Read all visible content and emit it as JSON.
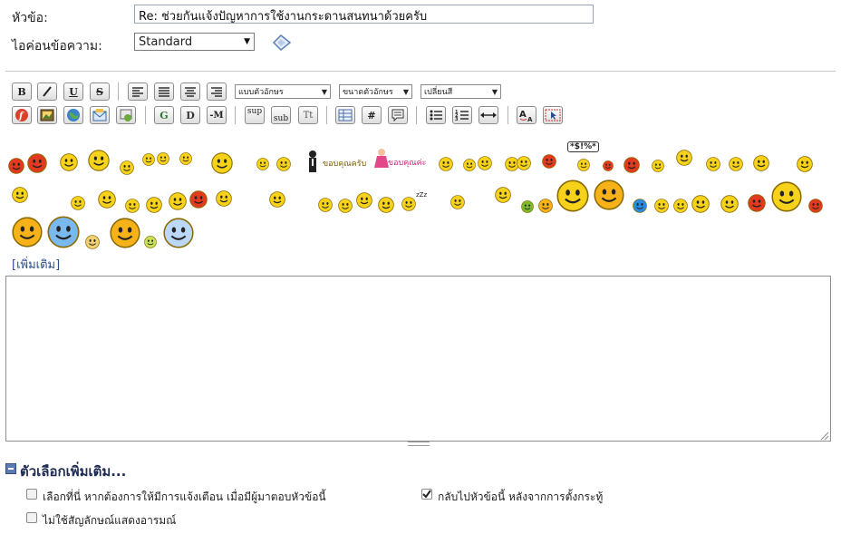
{
  "form": {
    "subject_label": "หัวข้อ:",
    "subject_value": "Re: ช่วยกันแจ้งปัญหาการใช้งานกระดานสนทนาด้วยครับ",
    "icon_label": "ไอค่อนข้อความ:",
    "icon_selected": "Standard"
  },
  "toolbar": {
    "bold": "B",
    "italic": "I",
    "underline": "U",
    "strike": "S",
    "font_select": "แบบตัวอักษร",
    "size_select": "ขนาดตัวอักษร",
    "color_select": "เปลี่ยนสี",
    "glow": "G",
    "shadow": "D",
    "move": "M",
    "sup": "sup",
    "sub": "sub",
    "teletype": "Tt",
    "code": "#"
  },
  "smileys": {
    "thanks_male": "ขอบคุณครับ",
    "thanks_female": "ขอบคุณค่ะ",
    "curse_bubble": "*$!%*",
    "zzz": "zZz",
    "more_link": "[เพิ่มเติม]"
  },
  "options": {
    "title": "ตัวเลือกเพิ่มเติม...",
    "items": [
      {
        "label": "เลือกที่นี่ หากต้องการให้มีการแจ้งเตือน เมื่อมีผู้มาตอบหัวข้อนี้",
        "checked": false
      },
      {
        "label": "กลับไปหัวข้อนี้ หลังจากการตั้งกระทู้",
        "checked": true
      },
      {
        "label": "ไม่ใช้สัญลักษณ์แสดงอารมณ์",
        "checked": false
      }
    ]
  }
}
